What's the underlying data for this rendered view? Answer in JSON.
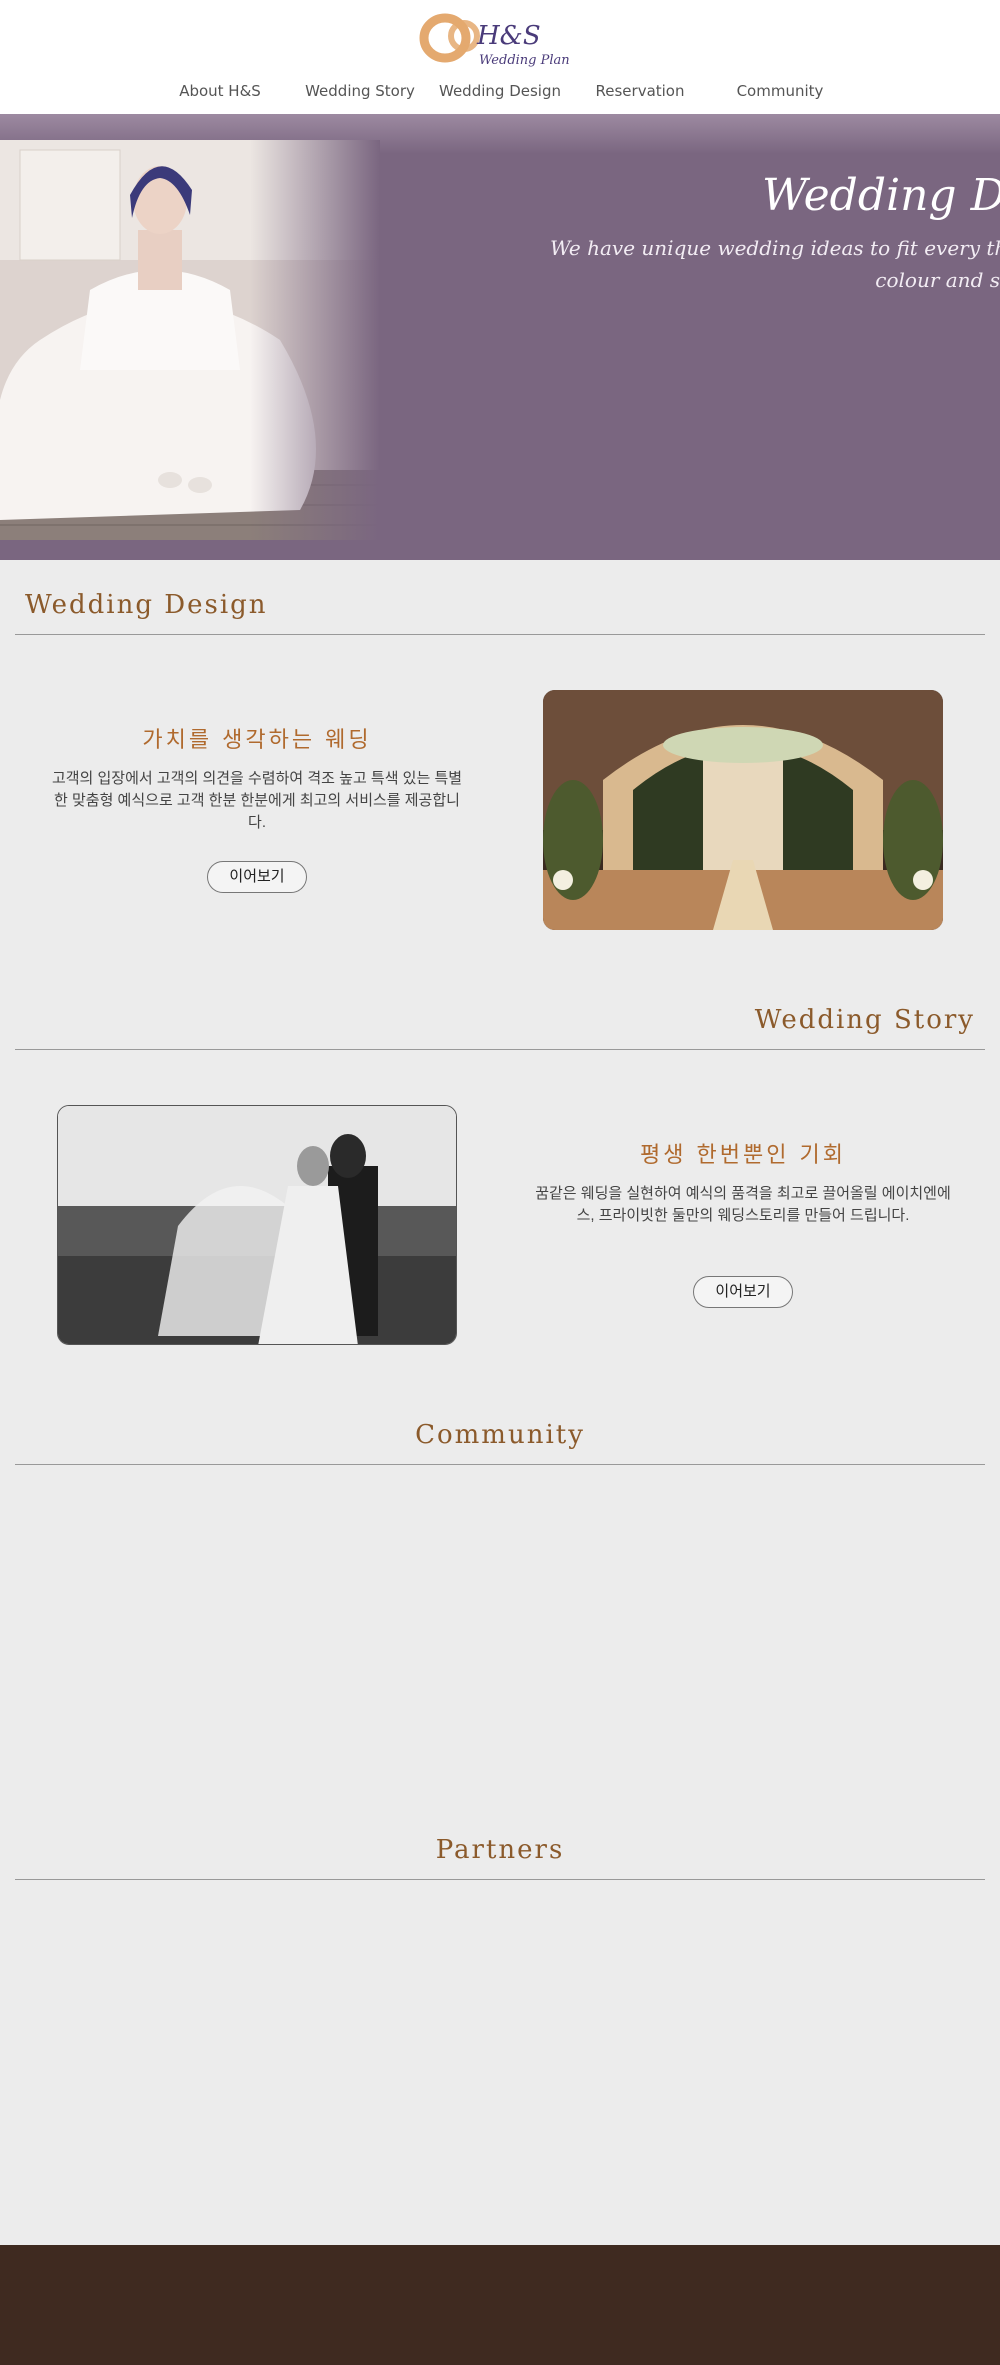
{
  "brand": {
    "name": "H&S",
    "tagline": "Wedding Plan",
    "colors": {
      "accent": "#8b5a2b",
      "hero_bg": "#7a6680",
      "footer_bg": "#3f2a20",
      "logo_ring": "#e4a96f",
      "logo_text": "#4a3b7a"
    }
  },
  "nav": {
    "items": [
      {
        "label": "About H&S"
      },
      {
        "label": "Wedding Story"
      },
      {
        "label": "Wedding Design"
      },
      {
        "label": "Reservation"
      },
      {
        "label": "Community"
      }
    ]
  },
  "hero": {
    "title": "Wedding Da",
    "subtitle_line1": "We have unique wedding ideas to fit every th",
    "subtitle_line2": "colour and s",
    "image": "bride-sitting-photo"
  },
  "sections": {
    "design": {
      "heading": "Wedding Design",
      "title": "가치를 생각하는 웨딩",
      "text": "고객의 입장에서 고객의 의견을 수렴하여 격조 높고 특색 있는 특별한 맞춤형 예식으로 고객 한분 한분에게 최고의 서비스를 제공합니다.",
      "button": "이어보기",
      "image": "wedding-hall-photo"
    },
    "story": {
      "heading": "Wedding Story",
      "title": "평생 한번뿐인 기회",
      "text": "꿈같은 웨딩을 실현하여 예식의 품격을 최고로 끌어올릴 에이치엔에스, 프라이빗한 둘만의 웨딩스토리를 만들어 드립니다.",
      "button": "이어보기",
      "image": "couple-kissing-photo"
    },
    "community": {
      "heading": "Community"
    },
    "partners": {
      "heading": "Partners"
    }
  }
}
